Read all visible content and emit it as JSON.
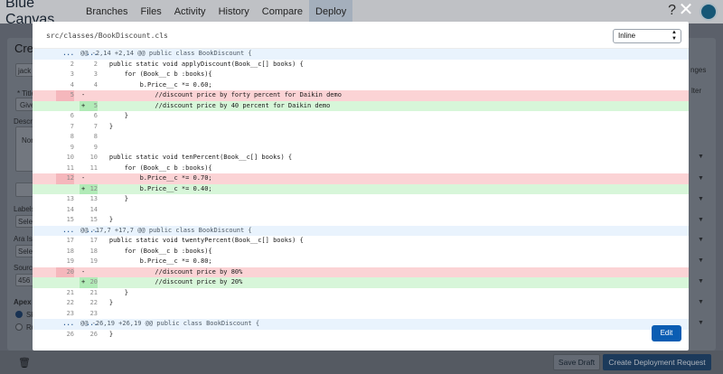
{
  "app": {
    "brand": "Blue Canvas",
    "nav": [
      "Branches",
      "Files",
      "Activity",
      "History",
      "Compare",
      "Deploy"
    ],
    "active_nav": "Deploy",
    "help": "?"
  },
  "background": {
    "title": "Crea",
    "labels": {
      "a": "jack",
      "b": "* Title",
      "c": "Give",
      "d": "Descri",
      "e": "Nor",
      "f": "Labels",
      "g": "Sele",
      "h": "Ara Iss",
      "i": "Sele",
      "j": "Source",
      "k": "456",
      "l": "Apex T",
      "m": "Sk",
      "n": "Ru",
      "o": "nges",
      "p": "lter"
    }
  },
  "footer": {
    "save_draft": "Save Draft",
    "create_request": "Create Deployment Request"
  },
  "modal": {
    "file_path": "src/classes/BookDiscount.cls",
    "view_mode": "Inline",
    "edit_label": "Edit",
    "close": "✕"
  },
  "diff_rows": [
    {
      "type": "hunk",
      "l1": "...",
      "l2": "...",
      "sign": "",
      "code": "@@ -2,14 +2,14 @@ public class BookDiscount {"
    },
    {
      "type": "ctx",
      "l1": "2",
      "l2": "2",
      "sign": "",
      "code": "    public static void applyDiscount(Book__c[] books) {"
    },
    {
      "type": "ctx",
      "l1": "3",
      "l2": "3",
      "sign": "",
      "code": "        for (Book__c b :books){"
    },
    {
      "type": "ctx",
      "l1": "4",
      "l2": "4",
      "sign": "",
      "code": "            b.Price__c *= 0.60;"
    },
    {
      "type": "del",
      "l1": "5",
      "l2": "",
      "sign": "-",
      "code": "                //discount price by forty percent for Daikin demo"
    },
    {
      "type": "add",
      "l1": "",
      "l2": "5",
      "sign": "+",
      "code": "                //discount price by 40 percent for Daikin demo"
    },
    {
      "type": "ctx",
      "l1": "6",
      "l2": "6",
      "sign": "",
      "code": "        }"
    },
    {
      "type": "ctx",
      "l1": "7",
      "l2": "7",
      "sign": "",
      "code": "    }"
    },
    {
      "type": "ctx",
      "l1": "8",
      "l2": "8",
      "sign": "",
      "code": ""
    },
    {
      "type": "ctx",
      "l1": "9",
      "l2": "9",
      "sign": "",
      "code": ""
    },
    {
      "type": "ctx",
      "l1": "10",
      "l2": "10",
      "sign": "",
      "code": "    public static void tenPercent(Book__c[] books) {"
    },
    {
      "type": "ctx",
      "l1": "11",
      "l2": "11",
      "sign": "",
      "code": "        for (Book__c b :books){"
    },
    {
      "type": "del",
      "l1": "12",
      "l2": "",
      "sign": "-",
      "code": "            b.Price__c *= 0.70;"
    },
    {
      "type": "add",
      "l1": "",
      "l2": "12",
      "sign": "+",
      "code": "            b.Price__c *= 0.40;"
    },
    {
      "type": "ctx",
      "l1": "13",
      "l2": "13",
      "sign": "",
      "code": "        }"
    },
    {
      "type": "ctx",
      "l1": "14",
      "l2": "14",
      "sign": "",
      "code": ""
    },
    {
      "type": "ctx",
      "l1": "15",
      "l2": "15",
      "sign": "",
      "code": "    }"
    },
    {
      "type": "hunk",
      "l1": "...",
      "l2": "...",
      "sign": "",
      "code": "@@ -17,7 +17,7 @@ public class BookDiscount {"
    },
    {
      "type": "ctx",
      "l1": "17",
      "l2": "17",
      "sign": "",
      "code": "    public static void twentyPercent(Book__c[] books) {"
    },
    {
      "type": "ctx",
      "l1": "18",
      "l2": "18",
      "sign": "",
      "code": "        for (Book__c b :books){"
    },
    {
      "type": "ctx",
      "l1": "19",
      "l2": "19",
      "sign": "",
      "code": "            b.Price__c *= 0.80;"
    },
    {
      "type": "del",
      "l1": "20",
      "l2": "",
      "sign": "-",
      "code": "                //discount price by 80%"
    },
    {
      "type": "add",
      "l1": "",
      "l2": "20",
      "sign": "+",
      "code": "                //discount price by 20%"
    },
    {
      "type": "ctx",
      "l1": "21",
      "l2": "21",
      "sign": "",
      "code": "        }"
    },
    {
      "type": "ctx",
      "l1": "22",
      "l2": "22",
      "sign": "",
      "code": "    }"
    },
    {
      "type": "ctx",
      "l1": "23",
      "l2": "23",
      "sign": "",
      "code": ""
    },
    {
      "type": "hunk",
      "l1": "...",
      "l2": "...",
      "sign": "",
      "code": "@@ -26,19 +26,19 @@ public class BookDiscount {"
    },
    {
      "type": "ctx",
      "l1": "26",
      "l2": "26",
      "sign": "",
      "code": "    }"
    }
  ]
}
